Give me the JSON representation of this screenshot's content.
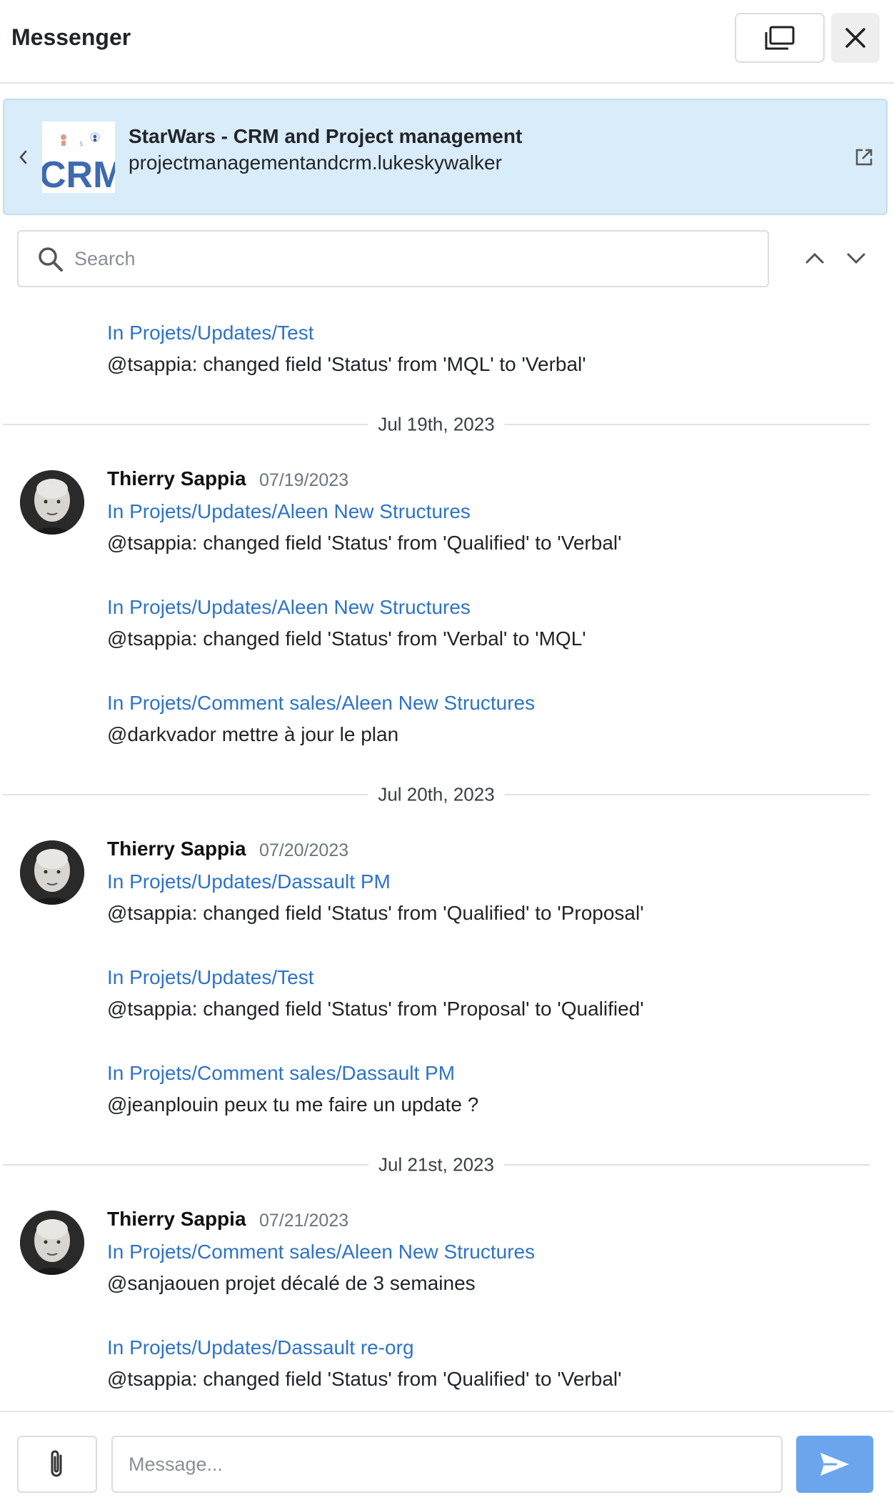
{
  "header": {
    "title": "Messenger"
  },
  "channel": {
    "name": "StarWars - CRM and Project management",
    "url": "projectmanagementandcrm.lukeskywalker",
    "logo_text": "CRM"
  },
  "search": {
    "placeholder": "Search"
  },
  "thread": {
    "orphan": {
      "link": "In Projets/Updates/Test",
      "text": "@tsappia: changed field 'Status' from 'MQL' to 'Verbal'"
    },
    "groups": [
      {
        "date_separator": "Jul 19th, 2023",
        "author": "Thierry Sappia",
        "date": "07/19/2023",
        "messages": [
          {
            "link": "In Projets/Updates/Aleen New Structures",
            "text": "@tsappia: changed field 'Status' from 'Qualified' to 'Verbal'"
          },
          {
            "link": "In Projets/Updates/Aleen New Structures",
            "text": "@tsappia: changed field 'Status' from 'Verbal' to 'MQL'"
          },
          {
            "link": "In Projets/Comment sales/Aleen New Structures",
            "text": "@darkvador mettre à jour le plan"
          }
        ]
      },
      {
        "date_separator": "Jul 20th, 2023",
        "author": "Thierry Sappia",
        "date": "07/20/2023",
        "messages": [
          {
            "link": "In Projets/Updates/Dassault PM",
            "text": "@tsappia: changed field 'Status' from 'Qualified' to 'Proposal'"
          },
          {
            "link": "In Projets/Updates/Test",
            "text": "@tsappia: changed field 'Status' from 'Proposal' to 'Qualified'"
          },
          {
            "link": "In Projets/Comment sales/Dassault PM",
            "text": "@jeanplouin peux tu me faire un update ?"
          }
        ]
      },
      {
        "date_separator": "Jul 21st, 2023",
        "author": "Thierry Sappia",
        "date": "07/21/2023",
        "messages": [
          {
            "link": "In Projets/Comment sales/Aleen New Structures",
            "text": "@sanjaouen projet décalé de 3 semaines"
          },
          {
            "link": "In Projets/Updates/Dassault re-org",
            "text": "@tsappia: changed field 'Status' from 'Qualified' to 'Verbal'"
          }
        ]
      }
    ]
  },
  "composer": {
    "placeholder": "Message..."
  },
  "colors": {
    "link": "#2e73c7",
    "channel_bg": "#d9ecf9",
    "send_button": "#6aa5ee"
  },
  "icons": {
    "popout": "window-popout-icon",
    "close": "close-icon",
    "back": "chevron-left-icon",
    "external": "external-link-icon",
    "search": "search-icon",
    "up": "chevron-up-icon",
    "down": "chevron-down-icon",
    "attach": "paperclip-icon",
    "send": "send-icon"
  }
}
